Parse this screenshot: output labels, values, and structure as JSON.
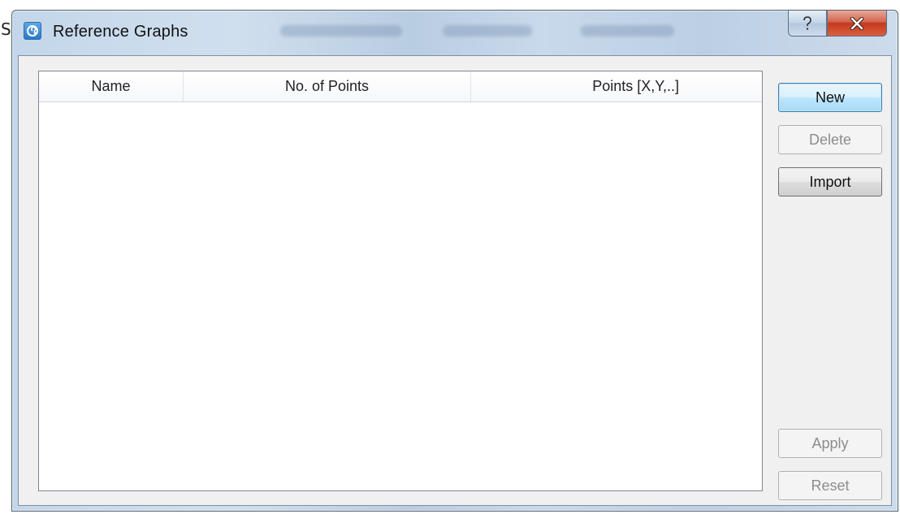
{
  "background_text": "S",
  "dialog": {
    "title": "Reference Graphs",
    "icon": "app-logo-icon",
    "caption_buttons": [
      {
        "name": "help",
        "icon": "question-mark-icon"
      },
      {
        "name": "close",
        "icon": "close-x-icon"
      }
    ]
  },
  "table": {
    "columns": [
      "Name",
      "No. of Points",
      "Points [X,Y,..]"
    ],
    "rows": []
  },
  "buttons": {
    "new": "New",
    "delete": "Delete",
    "import": "Import",
    "apply": "Apply",
    "reset": "Reset"
  },
  "colors": {
    "titlebar": "#c3d7ea",
    "client": "#f0f0f0",
    "default_button_border": "#3c7fb1",
    "close_button": "#c4391d"
  }
}
